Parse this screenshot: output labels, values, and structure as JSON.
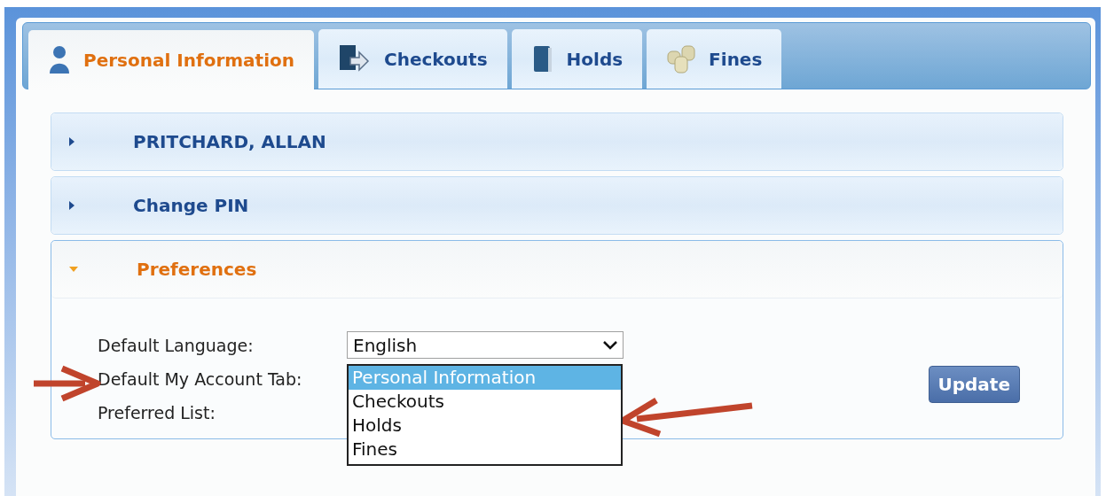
{
  "tabs": [
    {
      "label": "Personal Information",
      "selected": true
    },
    {
      "label": "Checkouts",
      "selected": false
    },
    {
      "label": "Holds",
      "selected": false
    },
    {
      "label": "Fines",
      "selected": false
    }
  ],
  "sections": [
    {
      "title": "PRITCHARD, ALLAN",
      "expanded": false
    },
    {
      "title": "Change PIN",
      "expanded": false
    },
    {
      "title": "Preferences",
      "expanded": true,
      "fields": [
        {
          "kind": "dropdown",
          "label": "Default Language:",
          "value": "English"
        },
        {
          "kind": "listbox",
          "label": "Default My Account Tab:",
          "options": [
            {
              "label": "Personal Information",
              "selected": true
            },
            {
              "label": "Checkouts",
              "selected": false
            },
            {
              "label": "Holds",
              "selected": false
            },
            {
              "label": "Fines",
              "selected": false
            }
          ]
        },
        {
          "kind": "blank",
          "label": "Preferred List:"
        }
      ],
      "button": "Update"
    }
  ]
}
